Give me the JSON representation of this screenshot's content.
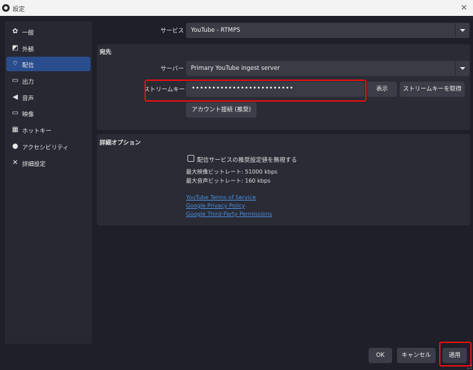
{
  "window": {
    "title": "設定",
    "close_glyph": "✕"
  },
  "sidebar": {
    "items": [
      {
        "label": "一般",
        "icon": "gear-icon",
        "glyph": "✿",
        "active": false
      },
      {
        "label": "外観",
        "icon": "appearance-icon",
        "glyph": "◩",
        "active": false
      },
      {
        "label": "配信",
        "icon": "broadcast-icon",
        "glyph": "⌔",
        "active": true
      },
      {
        "label": "出力",
        "icon": "output-icon",
        "glyph": "▭",
        "active": false
      },
      {
        "label": "音声",
        "icon": "speaker-icon",
        "glyph": "◀",
        "active": false
      },
      {
        "label": "映像",
        "icon": "monitor-icon",
        "glyph": "▭",
        "active": false
      },
      {
        "label": "ホットキー",
        "icon": "keyboard-icon",
        "glyph": "▦",
        "active": false
      },
      {
        "label": "アクセシビリティ",
        "icon": "accessibility-icon",
        "glyph": "●",
        "active": false
      },
      {
        "label": "詳細設定",
        "icon": "tools-icon",
        "glyph": "✕",
        "active": false
      }
    ],
    "active_color": "#2a4e8d"
  },
  "service": {
    "label": "サービス",
    "value": "YouTube - RTMPS"
  },
  "destination": {
    "title": "宛先",
    "server_label": "サーバー",
    "server_value": "Primary YouTube ingest server",
    "key_label": "ストリームキー",
    "key_value": "•••••••••••••••••••••••••",
    "show_button": "表示",
    "get_key_button": "ストリームキーを取得",
    "connect_button": "アカウント接続 (推奨)"
  },
  "advanced": {
    "title": "詳細オプション",
    "ignore_checkbox_label": "配信サービスの推奨設定値を無視する",
    "ignore_checked": false,
    "max_video_bitrate": "最大映像ビットレート: 51000 kbps",
    "max_audio_bitrate": "最大音声ビットレート: 160 kbps",
    "links": [
      "YouTube Terms of Service",
      "Google Privacy Policy",
      "Google Third-Party Permissions"
    ]
  },
  "footer": {
    "ok": "OK",
    "cancel": "キャンセル",
    "apply": "適用"
  },
  "colors": {
    "background": "#1e1f29",
    "panel": "#2a2b35",
    "highlight": "#e81010",
    "link": "#4a8fe0"
  }
}
